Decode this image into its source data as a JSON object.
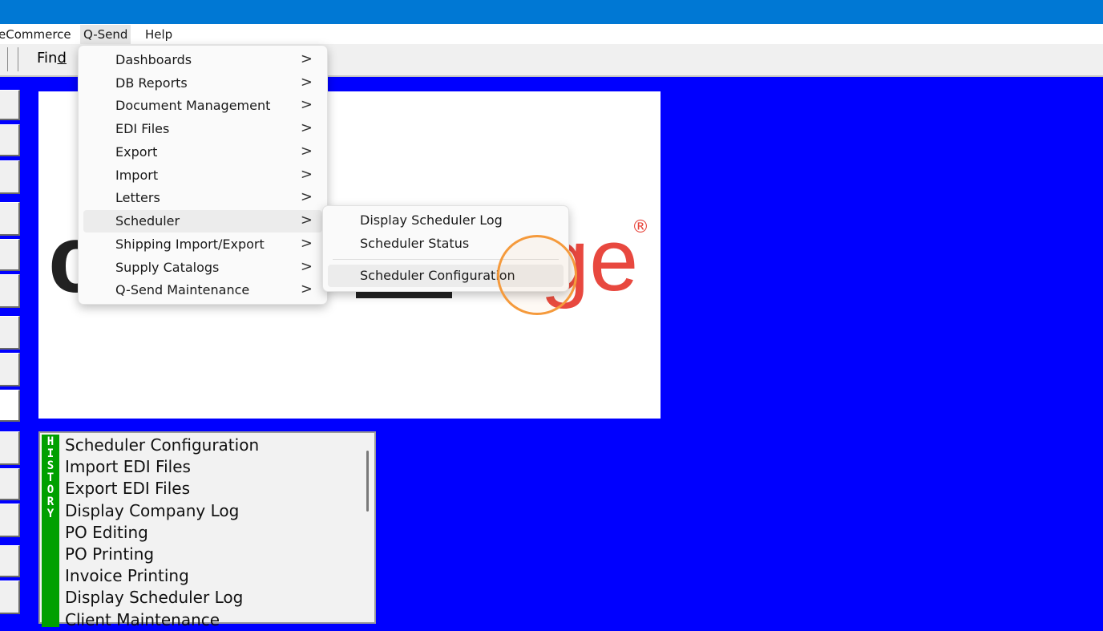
{
  "menubar": {
    "items": [
      "eCommerce",
      "Q-Send",
      "Help"
    ]
  },
  "toolbar": {
    "find_prefix": "Fin",
    "find_underlined": "d"
  },
  "qsend_menu": {
    "items": [
      {
        "label": "Dashboards"
      },
      {
        "label": "DB Reports"
      },
      {
        "label": "Document Management"
      },
      {
        "label": "EDI Files"
      },
      {
        "label": "Export"
      },
      {
        "label": "Import"
      },
      {
        "label": "Letters"
      },
      {
        "label": "Scheduler"
      },
      {
        "label": "Shipping Import/Export"
      },
      {
        "label": "Supply Catalogs"
      },
      {
        "label": "Q-Send Maintenance"
      }
    ],
    "arrow": ">"
  },
  "scheduler_submenu": {
    "items": [
      {
        "label": "Display Scheduler Log"
      },
      {
        "label": "Scheduler Status"
      },
      {
        "label": "Scheduler Configuration"
      }
    ]
  },
  "logo": {
    "registered_mark": "®",
    "partial_text_right": "ge",
    "partial_text_left": "c",
    "colors": {
      "orange_red": "#e8483f",
      "dark": "#222222"
    }
  },
  "history": {
    "tab_letters": [
      "H",
      "I",
      "S",
      "T",
      "O",
      "R",
      "Y"
    ],
    "items": [
      "Scheduler Configuration",
      "Import EDI Files",
      "Export EDI Files",
      "Display Company Log",
      "PO Editing",
      "PO Printing",
      "Invoice Printing",
      "Display Scheduler Log",
      "Client Maintenance"
    ]
  },
  "colors": {
    "titlebar": "#0078d4",
    "background": "#0000ff",
    "history_tab": "#00a000",
    "click_indicator": "#f59a3c"
  }
}
